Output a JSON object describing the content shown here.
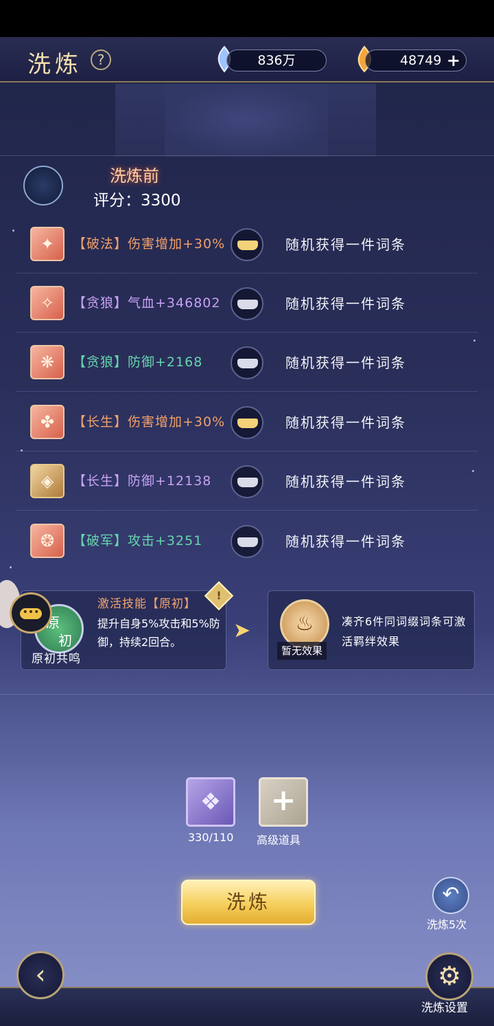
{
  "header": {
    "title": "洗炼",
    "help_icon": "question-icon",
    "currency_silver": "836万",
    "currency_gold": "48749",
    "add_label": "+"
  },
  "pre": {
    "title": "洗炼前",
    "score_label": "评分：",
    "score_value": "3300"
  },
  "rows": [
    {
      "tag": "【破法】",
      "effect": "伤害增加+30%",
      "color": "#f2a06a",
      "locked": "gold",
      "result": "随机获得一件词条"
    },
    {
      "tag": "【贪狼】",
      "effect": "气血+346802",
      "color": "#c7a2f2",
      "locked": "silver",
      "result": "随机获得一件词条"
    },
    {
      "tag": "【贪狼】",
      "effect": "防御+2168",
      "color": "#66d5ad",
      "locked": "silver",
      "result": "随机获得一件词条"
    },
    {
      "tag": "【长生】",
      "effect": "伤害增加+30%",
      "color": "#f2a06a",
      "locked": "gold",
      "result": "随机获得一件词条"
    },
    {
      "tag": "【长生】",
      "effect": "防御+12138",
      "color": "#c7a2f2",
      "locked": "silver",
      "result": "随机获得一件词条"
    },
    {
      "tag": "【破军】",
      "effect": "攻击+3251",
      "color": "#66d5ad",
      "locked": "silver",
      "result": "随机获得一件词条"
    }
  ],
  "skill": {
    "badge_top": "原",
    "badge_bottom": "初",
    "name": "原初共鸣",
    "title": "激活技能【原初】",
    "desc": "提升自身5%攻击和5%防御，持续2回合。",
    "warn": "!"
  },
  "bond": {
    "label": "暂无效果",
    "desc": "凑齐6件同词缀词条可激活羁绊效果"
  },
  "materials": {
    "crystal_count": "330/110",
    "advanced_label": "高级道具"
  },
  "actions": {
    "wash": "洗炼",
    "undo_label": "洗炼5次",
    "settings_label": "洗炼设置"
  }
}
